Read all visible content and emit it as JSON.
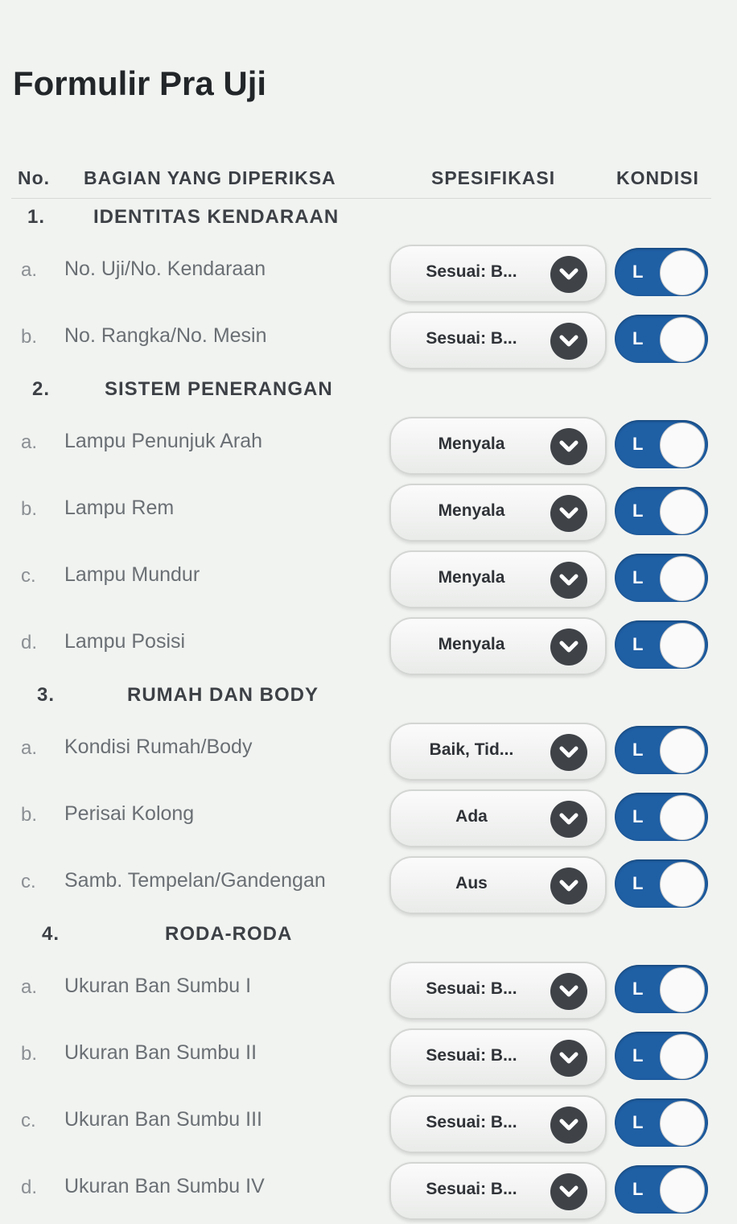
{
  "page_title": "Formulir Pra Uji",
  "columns": {
    "no": "No.",
    "part": "BAGIAN YANG DIPERIKSA",
    "spec": "SPESIFIKASI",
    "condition": "KONDISI"
  },
  "rows": [
    {
      "kind": "section",
      "num": "1.",
      "title": "IDENTITAS KENDARAAN"
    },
    {
      "kind": "item",
      "letter": "a.",
      "label": "No. Uji/No. Kendaraan",
      "spec": "Sesuai: B...",
      "toggle": "L"
    },
    {
      "kind": "item",
      "letter": "b.",
      "label": "No. Rangka/No. Mesin",
      "spec": "Sesuai: B...",
      "toggle": "L"
    },
    {
      "kind": "section",
      "num": "2.",
      "title": "SISTEM PENERANGAN"
    },
    {
      "kind": "item",
      "letter": "a.",
      "label": "Lampu Penunjuk Arah",
      "spec": "Menyala",
      "toggle": "L"
    },
    {
      "kind": "item",
      "letter": "b.",
      "label": "Lampu Rem",
      "spec": "Menyala",
      "toggle": "L"
    },
    {
      "kind": "item",
      "letter": "c.",
      "label": "Lampu Mundur",
      "spec": "Menyala",
      "toggle": "L"
    },
    {
      "kind": "item",
      "letter": "d.",
      "label": "Lampu Posisi",
      "spec": "Menyala",
      "toggle": "L"
    },
    {
      "kind": "section",
      "num": "3.",
      "title": "RUMAH DAN BODY"
    },
    {
      "kind": "item",
      "letter": "a.",
      "label": "Kondisi Rumah/Body",
      "spec": "Baik, Tid...",
      "toggle": "L"
    },
    {
      "kind": "item",
      "letter": "b.",
      "label": "Perisai Kolong",
      "spec": "Ada",
      "toggle": "L"
    },
    {
      "kind": "item",
      "letter": "c.",
      "label": "Samb. Tempelan/Gandengan",
      "spec": "Aus",
      "toggle": "L"
    },
    {
      "kind": "section",
      "num": "4.",
      "title": "RODA-RODA"
    },
    {
      "kind": "item",
      "letter": "a.",
      "label": "Ukuran Ban Sumbu I",
      "spec": "Sesuai: B...",
      "toggle": "L"
    },
    {
      "kind": "item",
      "letter": "b.",
      "label": "Ukuran Ban Sumbu II",
      "spec": "Sesuai: B...",
      "toggle": "L"
    },
    {
      "kind": "item",
      "letter": "c.",
      "label": "Ukuran Ban Sumbu III",
      "spec": "Sesuai: B...",
      "toggle": "L"
    },
    {
      "kind": "item",
      "letter": "d.",
      "label": "Ukuran Ban Sumbu IV",
      "spec": "Sesuai: B...",
      "toggle": "L"
    }
  ],
  "colors": {
    "toggle_on": "#1f5fa4",
    "chevron_bg": "#3f4348",
    "page_bg": "#f1f3f1"
  },
  "icons": {
    "select_chevron": "chevron-down-icon"
  }
}
